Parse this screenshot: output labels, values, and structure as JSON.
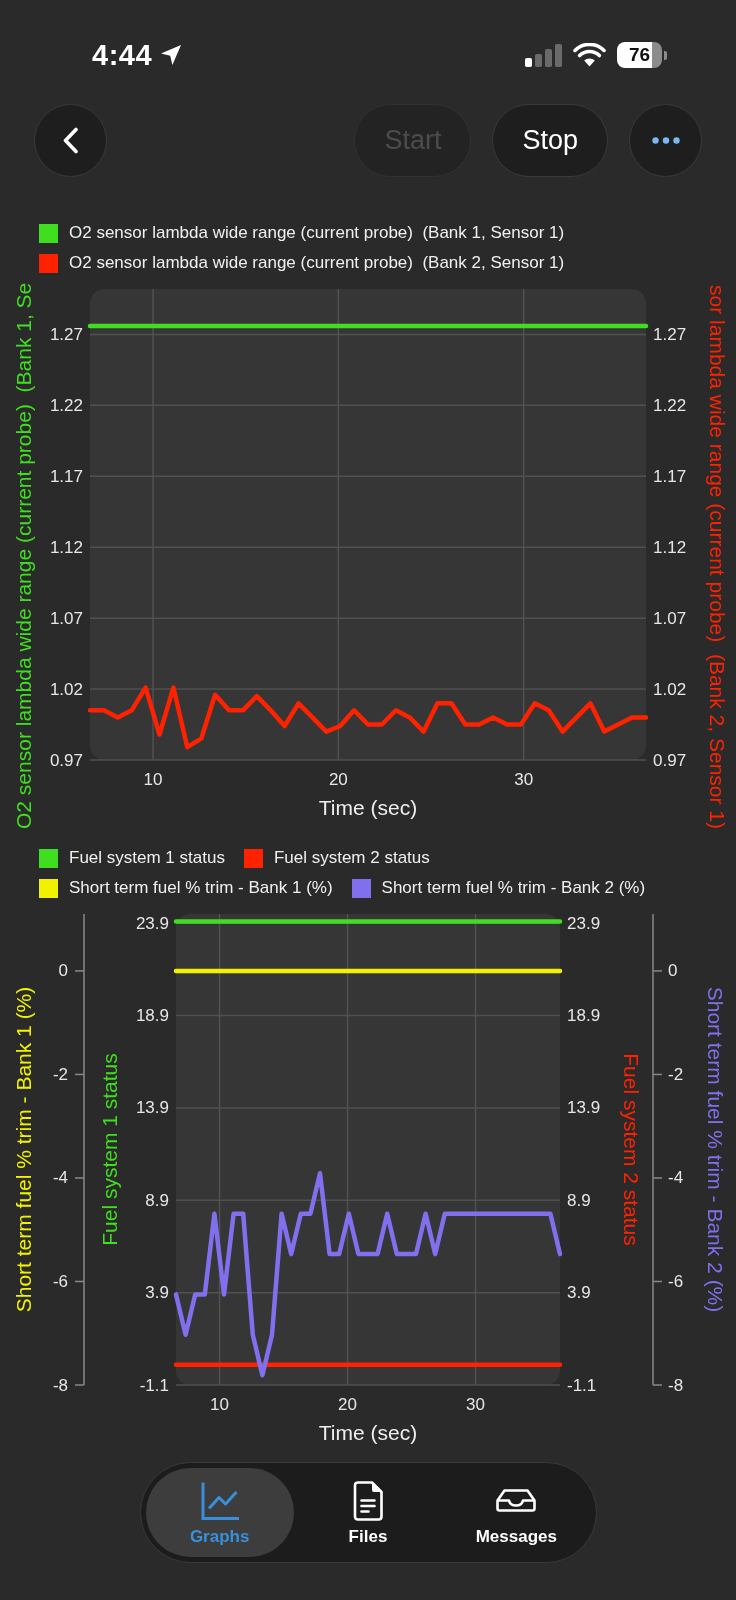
{
  "status_bar": {
    "time": "4:44",
    "battery": "76"
  },
  "toolbar": {
    "buttons": [
      {
        "label": "Start",
        "disabled": true
      },
      {
        "label": "Stop",
        "disabled": false
      }
    ]
  },
  "charts": [
    {
      "axes": [
        {
          "kind": "left",
          "chart_data": {
            "type": "line",
            "grid": true,
            "xlabel": "Time (sec)",
            "ylabel": "O2 sensor lambda wide range (current probe)  (Bank 1, Se",
            "x": [
              6.6,
              7.35,
              8.1,
              8.85,
              9.6,
              10.35,
              11.1,
              11.85,
              12.6,
              13.35,
              14.1,
              14.85,
              15.6,
              16.35,
              17.1,
              17.85,
              18.6,
              19.35,
              20.1,
              20.85,
              21.6,
              22.35,
              23.1,
              23.85,
              24.6,
              25.35,
              26.1,
              26.85,
              27.6,
              28.35,
              29.1,
              29.85,
              30.6,
              31.35,
              32.1,
              32.85,
              33.6,
              34.35,
              35.1,
              35.85,
              36.6
            ],
            "xlim": [
              6.6,
              36.6
            ],
            "xticks": [
              10,
              20,
              30
            ],
            "ylim": [
              0.97,
              1.302
            ],
            "yticks": [
              1.27,
              1.22,
              1.17,
              1.12,
              1.07,
              1.02,
              0.97
            ],
            "series": [
              {
                "name": "O2 sensor lambda wide range (current probe)  (Bank 1, Sensor 1)",
                "color": "#3fdf20",
                "values": [
                  1.276,
                  1.276,
                  1.276,
                  1.276,
                  1.276,
                  1.276,
                  1.276,
                  1.276,
                  1.276,
                  1.276,
                  1.276,
                  1.276,
                  1.276,
                  1.276,
                  1.276,
                  1.276,
                  1.276,
                  1.276,
                  1.276,
                  1.276,
                  1.276,
                  1.276,
                  1.276,
                  1.276,
                  1.276,
                  1.276,
                  1.276,
                  1.276,
                  1.276,
                  1.276,
                  1.276,
                  1.276,
                  1.276,
                  1.276,
                  1.276,
                  1.276,
                  1.276,
                  1.276,
                  1.276,
                  1.276,
                  1.276
                ]
              }
            ]
          }
        },
        {
          "kind": "right",
          "chart_data": {
            "type": "line",
            "ylabel": "sor lambda wide range (current probe)  (Bank 2, Sensor 1)",
            "x": [
              6.6,
              7.35,
              8.1,
              8.85,
              9.6,
              10.35,
              11.1,
              11.85,
              12.6,
              13.35,
              14.1,
              14.85,
              15.6,
              16.35,
              17.1,
              17.85,
              18.6,
              19.35,
              20.1,
              20.85,
              21.6,
              22.35,
              23.1,
              23.85,
              24.6,
              25.35,
              26.1,
              26.85,
              27.6,
              28.35,
              29.1,
              29.85,
              30.6,
              31.35,
              32.1,
              32.85,
              33.6,
              34.35,
              35.1,
              35.85,
              36.6
            ],
            "xlim": [
              6.6,
              36.6
            ],
            "ylim": [
              0.97,
              1.302
            ],
            "yticks": [
              1.27,
              1.22,
              1.17,
              1.12,
              1.07,
              1.02,
              0.97
            ],
            "series": [
              {
                "name": "O2 sensor lambda wide range (current probe)  (Bank 2, Sensor 1)",
                "color": "#ff2200",
                "values": [
                  1.005,
                  1.005,
                  1.0,
                  1.005,
                  1.021,
                  0.988,
                  1.021,
                  0.979,
                  0.985,
                  1.016,
                  1.005,
                  1.005,
                  1.015,
                  1.005,
                  0.994,
                  1.01,
                  1.0,
                  0.99,
                  0.994,
                  1.005,
                  0.995,
                  0.995,
                  1.005,
                  1.0,
                  0.99,
                  1.01,
                  1.01,
                  0.995,
                  0.995,
                  1.0,
                  0.995,
                  0.995,
                  1.01,
                  1.005,
                  0.99,
                  1.0,
                  1.01,
                  0.99,
                  0.995,
                  1.0,
                  1.0
                ]
              }
            ]
          }
        }
      ]
    },
    {
      "axes": [
        {
          "kind": "left",
          "chart_data": {
            "type": "line",
            "grid": true,
            "xlabel": "Time (sec)",
            "ylabel": "Fuel system 1 status",
            "x": [
              6.6,
              7.35,
              8.1,
              8.85,
              9.6,
              10.35,
              11.1,
              11.85,
              12.6,
              13.35,
              14.1,
              14.85,
              15.6,
              16.35,
              17.1,
              17.85,
              18.6,
              19.35,
              20.1,
              20.85,
              21.6,
              22.35,
              23.1,
              23.85,
              24.6,
              25.35,
              26.1,
              26.85,
              27.6,
              28.35,
              29.1,
              29.85,
              30.6,
              31.35,
              32.1,
              32.85,
              33.6,
              34.35,
              35.1,
              35.85,
              36.6
            ],
            "xlim": [
              6.6,
              36.6
            ],
            "xticks": [
              10,
              20,
              30
            ],
            "ylim": [
              -1.1,
              24.4
            ],
            "yticks": [
              23.9,
              18.9,
              13.9,
              8.9,
              3.9,
              -1.1
            ],
            "series": [
              {
                "name": "Fuel system 1 status",
                "color": "#3fdf20",
                "values": [
                  24,
                  24,
                  24,
                  24,
                  24,
                  24,
                  24,
                  24,
                  24,
                  24,
                  24,
                  24,
                  24,
                  24,
                  24,
                  24,
                  24,
                  24,
                  24,
                  24,
                  24,
                  24,
                  24,
                  24,
                  24,
                  24,
                  24,
                  24,
                  24,
                  24,
                  24,
                  24,
                  24,
                  24,
                  24,
                  24,
                  24,
                  24,
                  24,
                  24,
                  24
                ]
              }
            ]
          }
        },
        {
          "kind": "right",
          "chart_data": {
            "type": "line",
            "ylabel": "Fuel system 2 status",
            "x": [
              6.6,
              7.35,
              8.1,
              8.85,
              9.6,
              10.35,
              11.1,
              11.85,
              12.6,
              13.35,
              14.1,
              14.85,
              15.6,
              16.35,
              17.1,
              17.85,
              18.6,
              19.35,
              20.1,
              20.85,
              21.6,
              22.35,
              23.1,
              23.85,
              24.6,
              25.35,
              26.1,
              26.85,
              27.6,
              28.35,
              29.1,
              29.85,
              30.6,
              31.35,
              32.1,
              32.85,
              33.6,
              34.35,
              35.1,
              35.85,
              36.6
            ],
            "xlim": [
              6.6,
              36.6
            ],
            "ylim": [
              -1.1,
              24.4
            ],
            "yticks": [
              23.9,
              18.9,
              13.9,
              8.9,
              3.9,
              -1.1
            ],
            "series": [
              {
                "name": "Fuel system 2 status",
                "color": "#ff2200",
                "values": [
                  0,
                  0,
                  0,
                  0,
                  0,
                  0,
                  0,
                  0,
                  0,
                  0,
                  0,
                  0,
                  0,
                  0,
                  0,
                  0,
                  0,
                  0,
                  0,
                  0,
                  0,
                  0,
                  0,
                  0,
                  0,
                  0,
                  0,
                  0,
                  0,
                  0,
                  0,
                  0,
                  0,
                  0,
                  0,
                  0,
                  0,
                  0,
                  0,
                  0,
                  0
                ]
              }
            ]
          }
        },
        {
          "kind": "farleft",
          "chart_data": {
            "type": "line",
            "ylabel": "Short term fuel % trim - Bank 1 (%)",
            "x": [
              6.6,
              7.35,
              8.1,
              8.85,
              9.6,
              10.35,
              11.1,
              11.85,
              12.6,
              13.35,
              14.1,
              14.85,
              15.6,
              16.35,
              17.1,
              17.85,
              18.6,
              19.35,
              20.1,
              20.85,
              21.6,
              22.35,
              23.1,
              23.85,
              24.6,
              25.35,
              26.1,
              26.85,
              27.6,
              28.35,
              29.1,
              29.85,
              30.6,
              31.35,
              32.1,
              32.85,
              33.6,
              34.35,
              35.1,
              35.85,
              36.6
            ],
            "xlim": [
              6.6,
              36.6
            ],
            "ylim": [
              -8,
              1.1
            ],
            "yticks": [
              0,
              -2,
              -4,
              -6,
              -8
            ],
            "series": [
              {
                "name": "Short term fuel % trim - Bank 1 (%)",
                "color": "#f2f200",
                "values": [
                  0,
                  0,
                  0,
                  0,
                  0,
                  0,
                  0,
                  0,
                  0,
                  0,
                  0,
                  0,
                  0,
                  0,
                  0,
                  0,
                  0,
                  0,
                  0,
                  0,
                  0,
                  0,
                  0,
                  0,
                  0,
                  0,
                  0,
                  0,
                  0,
                  0,
                  0,
                  0,
                  0,
                  0,
                  0,
                  0,
                  0,
                  0,
                  0,
                  0,
                  0
                ]
              }
            ]
          }
        },
        {
          "kind": "farright",
          "chart_data": {
            "type": "line",
            "ylabel": "Short term fuel % trim - Bank 2 (%)",
            "x": [
              6.6,
              7.35,
              8.1,
              8.85,
              9.6,
              10.35,
              11.1,
              11.85,
              12.6,
              13.35,
              14.1,
              14.85,
              15.6,
              16.35,
              17.1,
              17.85,
              18.6,
              19.35,
              20.1,
              20.85,
              21.6,
              22.35,
              23.1,
              23.85,
              24.6,
              25.35,
              26.1,
              26.85,
              27.6,
              28.35,
              29.1,
              29.85,
              30.6,
              31.35,
              32.1,
              32.85,
              33.6,
              34.35,
              35.1,
              35.85,
              36.6
            ],
            "xlim": [
              6.6,
              36.6
            ],
            "ylim": [
              -8,
              1.1
            ],
            "yticks": [
              0,
              -2,
              -4,
              -6,
              -8
            ],
            "series": [
              {
                "name": "Short term fuel % trim - Bank 2 (%)",
                "color": "#8070ee",
                "values": [
                  -6.25,
                  -7.03,
                  -6.25,
                  -6.25,
                  -4.69,
                  -6.25,
                  -4.69,
                  -4.69,
                  -7.03,
                  -7.81,
                  -7.03,
                  -4.69,
                  -5.47,
                  -4.69,
                  -4.69,
                  -3.91,
                  -5.47,
                  -5.47,
                  -4.69,
                  -5.47,
                  -5.47,
                  -5.47,
                  -4.69,
                  -5.47,
                  -5.47,
                  -5.47,
                  -4.69,
                  -5.47,
                  -4.69,
                  -4.69,
                  -4.69,
                  -4.69,
                  -4.69,
                  -4.69,
                  -4.69,
                  -4.69,
                  -4.69,
                  -4.69,
                  -4.69,
                  -4.69,
                  -5.47
                ]
              }
            ]
          }
        }
      ]
    }
  ],
  "tabs": [
    {
      "label": "Graphs",
      "selected": true
    },
    {
      "label": "Files",
      "selected": false
    },
    {
      "label": "Messages",
      "selected": false
    }
  ]
}
